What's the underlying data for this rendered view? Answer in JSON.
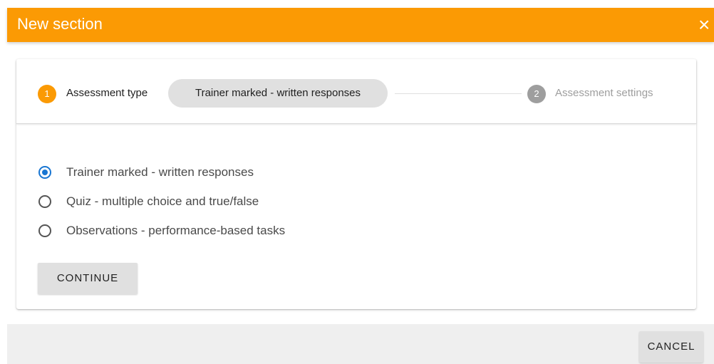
{
  "header": {
    "title": "New section",
    "close_icon": "×",
    "colors": {
      "accent": "#fb9a04"
    }
  },
  "stepper": {
    "steps": [
      {
        "number": "1",
        "label": "Assessment type",
        "selected_value": "Trainer marked - written responses",
        "status": "active"
      },
      {
        "number": "2",
        "label": "Assessment settings",
        "status": "inactive"
      }
    ]
  },
  "options": [
    {
      "label": "Trainer marked - written responses",
      "checked": true
    },
    {
      "label": "Quiz - multiple choice and true/false",
      "checked": false
    },
    {
      "label": "Observations - performance-based tasks",
      "checked": false
    }
  ],
  "buttons": {
    "continue": "CONTINUE",
    "cancel": "CANCEL"
  }
}
